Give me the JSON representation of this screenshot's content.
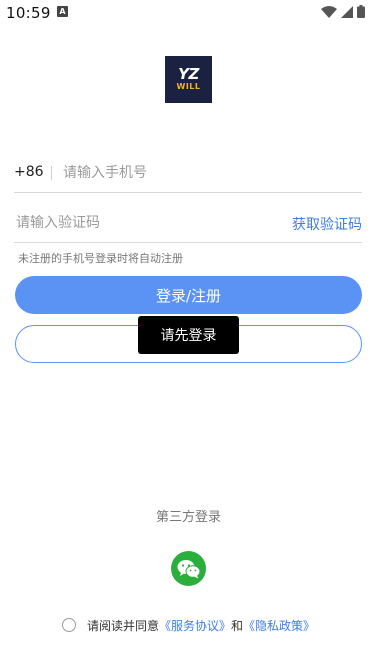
{
  "status_bar": {
    "time": "10:59",
    "notification": "A"
  },
  "logo": {
    "top": "YZ",
    "bottom": "WILL"
  },
  "phone": {
    "country_code": "+86",
    "placeholder": "请输入手机号"
  },
  "code": {
    "placeholder": "请输入验证码",
    "get_code_label": "获取验证码"
  },
  "hint": "未注册的手机号登录时将自动注册",
  "login_button": "登录/注册",
  "toast": "请先登录",
  "third_party": {
    "title": "第三方登录",
    "wechat_icon": "wechat-icon"
  },
  "agreement": {
    "prefix": "请阅读并同意",
    "service_link": "《服务协议》",
    "and": "和",
    "privacy_link": "《隐私政策》"
  },
  "colors": {
    "accent": "#5b93f5",
    "link": "#3d7de4",
    "wechat": "#2aae3c",
    "logo_bg": "#1b2140",
    "logo_accent": "#f3b12c"
  }
}
